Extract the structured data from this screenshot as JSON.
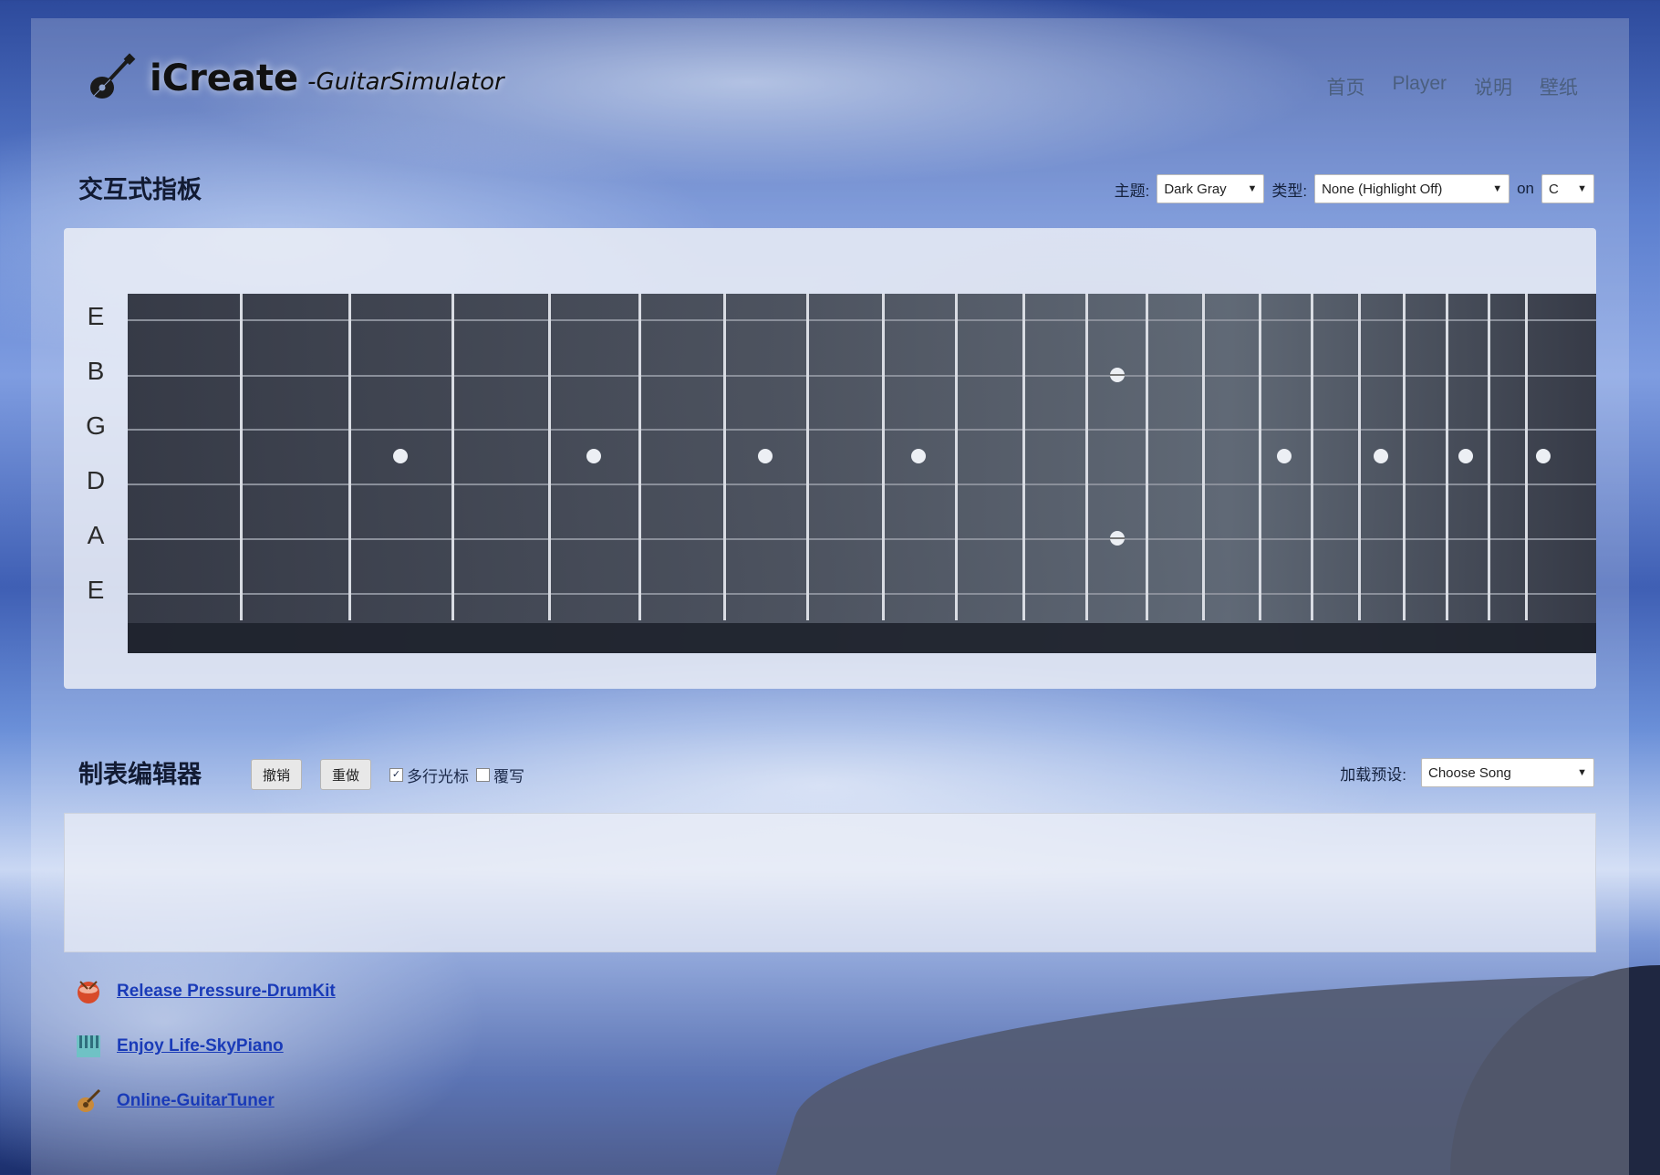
{
  "header": {
    "logo_title": "iCreate",
    "logo_subtitle": "-GuitarSimulator",
    "logo_icon": "guitar-icon"
  },
  "nav": {
    "items": [
      "首页",
      "Player",
      "说明",
      "壁纸"
    ]
  },
  "fretboard_section": {
    "title": "交互式指板",
    "theme_label": "主题:",
    "theme_value": "Dark Gray",
    "type_label": "类型:",
    "type_value": "None (Highlight Off)",
    "on_label": "on",
    "key_value": "C",
    "string_labels": [
      "E",
      "B",
      "G",
      "D",
      "A",
      "E"
    ],
    "fret_count": 19
  },
  "tab_editor": {
    "title": "制表编辑器",
    "undo_label": "撤销",
    "redo_label": "重做",
    "multiline_cursor_label": "多行光标",
    "multiline_cursor_checked": true,
    "overwrite_label": "覆写",
    "overwrite_checked": false,
    "preset_label": "加载预设:",
    "preset_value": "Choose Song"
  },
  "links": [
    {
      "label": "Release Pressure-DrumKit",
      "icon": "drum-icon"
    },
    {
      "label": "Enjoy Life-SkyPiano",
      "icon": "piano-icon"
    },
    {
      "label": "Online-GuitarTuner",
      "icon": "tuner-icon"
    }
  ],
  "colors": {
    "link": "#1a3bb8",
    "fretboard": "#2e3340",
    "panel": "#eef0f7"
  }
}
